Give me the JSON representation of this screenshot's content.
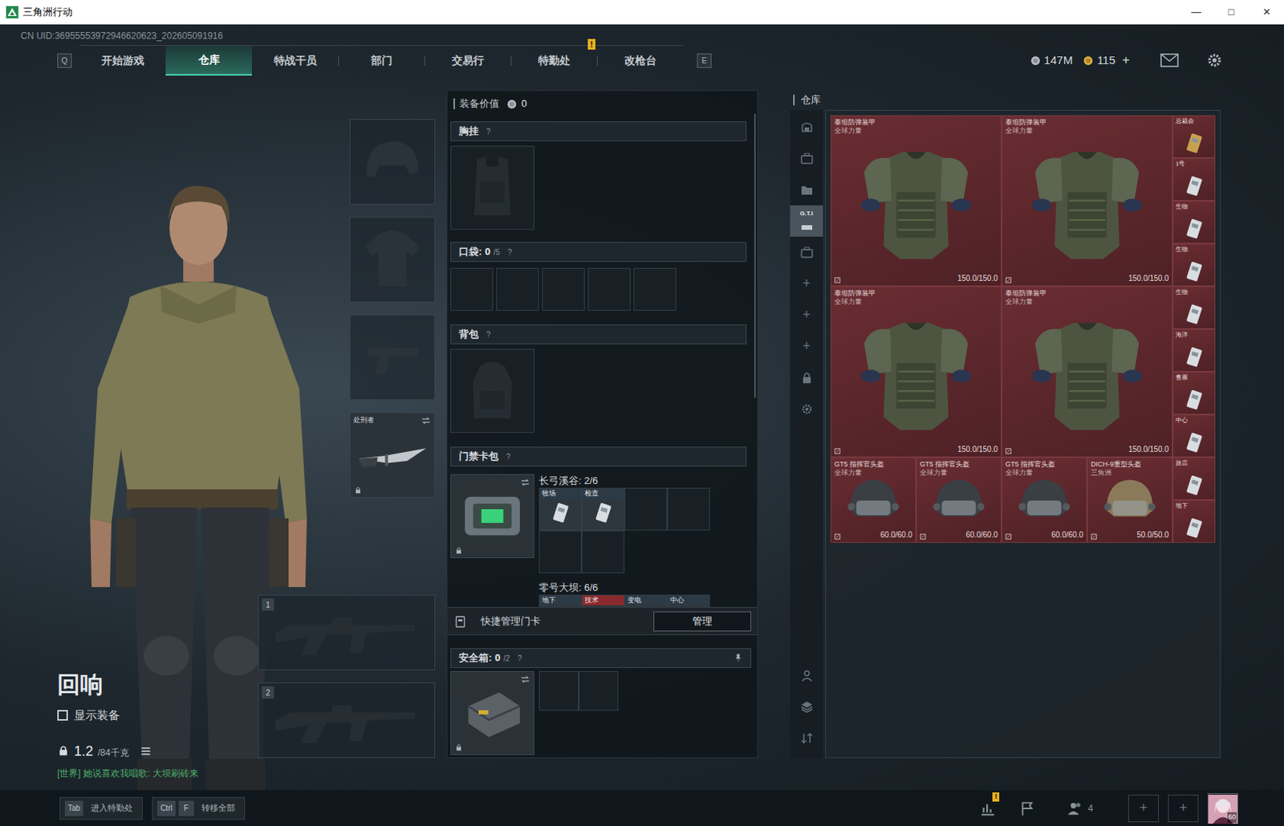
{
  "window": {
    "title": "三角洲行动",
    "controls": [
      "—",
      "□",
      "✕"
    ]
  },
  "uid": "CN UID:36955553972946620623_202605091916",
  "nav": {
    "prev_key": "Q",
    "next_key": "E",
    "tabs": [
      {
        "label": "开始游戏",
        "selected": false,
        "alert": false
      },
      {
        "label": "仓库",
        "selected": true,
        "alert": false
      },
      {
        "label": "特战干员",
        "selected": false,
        "alert": false
      },
      {
        "label": "部门",
        "selected": false,
        "alert": false
      },
      {
        "label": "交易行",
        "selected": false,
        "alert": false
      },
      {
        "label": "特勤处",
        "selected": false,
        "alert": true,
        "badge": "!"
      },
      {
        "label": "改枪台",
        "selected": false,
        "alert": false
      }
    ]
  },
  "wallet": [
    {
      "kind": "silver",
      "amount": "147M"
    },
    {
      "kind": "gold",
      "amount": "115",
      "action": "+"
    }
  ],
  "character": {
    "name": "回响",
    "show_equipment": {
      "label": "显示装备",
      "checked": false
    },
    "weight": "1.2",
    "capacity": "/84千克",
    "chat": "[世界] 她说喜欢我唱歌: 大坝刷砖来"
  },
  "equipment": [
    {
      "kind": "helmet",
      "equipped": false
    },
    {
      "kind": "armor",
      "equipped": false
    },
    {
      "kind": "pistol",
      "equipped": false
    },
    {
      "kind": "melee",
      "equipped": true,
      "name": "处刑者",
      "locked": true
    }
  ],
  "weapons": [
    {
      "slot": "1",
      "equipped": false
    },
    {
      "slot": "2",
      "equipped": false
    }
  ],
  "loadout": {
    "value_label": "装备价值",
    "value": "0",
    "chest_rig": {
      "label": "胸挂",
      "help": "?"
    },
    "pockets": {
      "label": "口袋:",
      "count": "0",
      "capacity": "/5",
      "help": "?",
      "slots": [
        {
          "filled": false
        },
        {
          "filled": false
        },
        {
          "filled": false
        },
        {
          "filled": false
        },
        {
          "filled": false
        }
      ]
    },
    "backpack": {
      "label": "背包",
      "help": "?"
    },
    "keycard_case": {
      "label": "门禁卡包",
      "help": "?",
      "locked": true,
      "maps": [
        {
          "title": "长弓溪谷: 2/6",
          "cards": [
            {
              "filled": true,
              "label": "牧场",
              "color": "#2c3a46"
            },
            {
              "filled": true,
              "label": "检查",
              "color": "#2c3a46"
            },
            {
              "filled": false
            },
            {
              "filled": false
            },
            {
              "filled": false
            },
            {
              "filled": false
            }
          ]
        },
        {
          "title": "零号大坝: 6/6",
          "cards": [
            {
              "filled": true,
              "label": "地下",
              "color": "#2c3a46"
            },
            {
              "filled": true,
              "label": "技术",
              "color": "#8b2a2e"
            },
            {
              "filled": true,
              "label": "变电",
              "color": "#2c3a46"
            },
            {
              "filled": true,
              "label": "中心",
              "color": "#2c3a46"
            }
          ]
        }
      ]
    },
    "quick_manage": {
      "label": "快捷管理门卡",
      "button": "管理"
    },
    "secure_case": {
      "label": "安全箱:",
      "count": "0",
      "capacity": "/2",
      "help": "?",
      "locked": true,
      "slots": [
        {
          "filled": false
        },
        {
          "filled": false
        }
      ]
    }
  },
  "warehouse": {
    "label": "仓库",
    "tools": [
      {
        "kind": "safe",
        "selected": false
      },
      {
        "kind": "case",
        "selected": false
      },
      {
        "kind": "folder",
        "selected": false
      },
      {
        "kind": "gti",
        "label": "G.T.I",
        "selected": true
      },
      {
        "kind": "case",
        "selected": false
      },
      {
        "kind": "add",
        "label": "+",
        "selected": false
      },
      {
        "kind": "add",
        "label": "+",
        "selected": false
      },
      {
        "kind": "add",
        "label": "+",
        "selected": false
      },
      {
        "kind": "lock",
        "selected": false
      },
      {
        "kind": "gear",
        "selected": false
      }
    ],
    "bottom_tools": [
      {
        "kind": "person",
        "selected": false
      },
      {
        "kind": "layers",
        "selected": false
      },
      {
        "kind": "sort",
        "selected": false
      }
    ],
    "items": [
      {
        "kind": "armor",
        "name": "泰坦防弹装甲",
        "brand": "全球力量",
        "durability": "150.0/150.0",
        "color": "#4d5540"
      },
      {
        "kind": "armor",
        "name": "泰坦防弹装甲",
        "brand": "全球力量",
        "durability": "150.0/150.0",
        "color": "#4d5540"
      },
      {
        "kind": "armor",
        "name": "泰坦防弹装甲",
        "brand": "全球力量",
        "durability": "150.0/150.0",
        "color": "#4d5540"
      },
      {
        "kind": "armor",
        "name": "泰坦防弹装甲",
        "brand": "全球力量",
        "durability": "150.0/150.0",
        "color": "#4d5540"
      },
      {
        "kind": "helmet",
        "name": "GT5 指挥官头盔",
        "brand": "全球力量",
        "durability": "60.0/60.0",
        "color": "#3a3f44"
      },
      {
        "kind": "helmet",
        "name": "GT5 指挥官头盔",
        "brand": "全球力量",
        "durability": "60.0/60.0",
        "color": "#3a3f44"
      },
      {
        "kind": "helmet",
        "name": "GT5 指挥官头盔",
        "brand": "全球力量",
        "durability": "60.0/60.0",
        "color": "#3a3f44"
      },
      {
        "kind": "helmet",
        "name": "DICH-9重型头盔",
        "brand": "三角洲",
        "durability": "50.0/50.0",
        "color": "#8a7a5a"
      }
    ],
    "keycards": [
      {
        "label": "总裁会",
        "color": "#c9a050"
      },
      {
        "label": "1号",
        "color": "#d8dde2"
      },
      {
        "label": "生物",
        "color": "#d8dde2"
      },
      {
        "label": "生物",
        "color": "#d8dde2"
      },
      {
        "label": "生物",
        "color": "#d8dde2"
      },
      {
        "label": "海洋",
        "color": "#d8dde2"
      },
      {
        "label": "售票",
        "color": "#d8dde2"
      },
      {
        "label": "中心",
        "color": "#d8dde2"
      },
      {
        "label": "旅店",
        "color": "#d8dde2"
      },
      {
        "label": "地下",
        "color": "#d8dde2"
      }
    ]
  },
  "bottom_bar": {
    "hints": [
      {
        "keys": [
          "Tab"
        ],
        "label": "进入特勤处"
      },
      {
        "keys": [
          "Ctrl",
          "F"
        ],
        "label": "转移全部"
      }
    ],
    "stats_badge": "!",
    "friends_count": "4",
    "add_slots": [
      "+",
      "+"
    ],
    "avatar_level": "60"
  }
}
